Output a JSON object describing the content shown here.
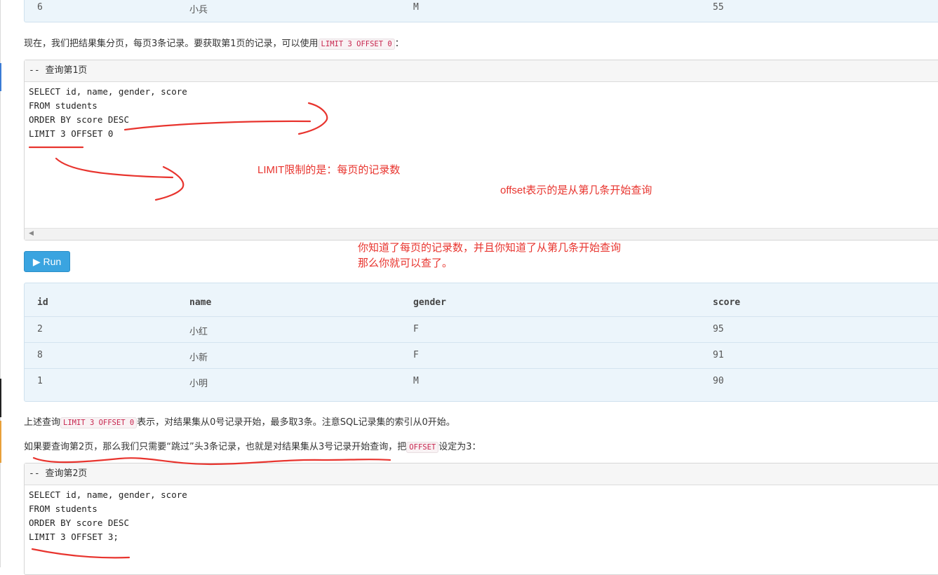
{
  "top_table_row": {
    "id": "6",
    "name": "小兵",
    "gender": "M",
    "score": "55"
  },
  "para1": {
    "before": "现在，我们把结果集分页，每页3条记录。要获取第1页的记录，可以使用",
    "code": "LIMIT 3 OFFSET 0",
    "after": "："
  },
  "code_block1": {
    "header": "-- 查询第1页",
    "lines": [
      "SELECT id, name, gender, score",
      "FROM students",
      "ORDER BY score DESC",
      "LIMIT 3 OFFSET 0"
    ]
  },
  "run_button": {
    "icon": "play-icon",
    "label": "▶ Run"
  },
  "result_table": {
    "columns": [
      "id",
      "name",
      "gender",
      "score"
    ],
    "rows": [
      [
        "2",
        "小红",
        "F",
        "95"
      ],
      [
        "8",
        "小新",
        "F",
        "91"
      ],
      [
        "1",
        "小明",
        "M",
        "90"
      ]
    ]
  },
  "para2": {
    "before": "上述查询",
    "code": "LIMIT 3 OFFSET 0",
    "after": "表示，对结果集从0号记录开始，最多取3条。注意SQL记录集的索引从0开始。"
  },
  "para3": {
    "before": "如果要查询第2页，那么我们只需要“跳过”头3条记录，也就是对结果集从3号记录开始查询，把",
    "code": "OFFSET",
    "after": "设定为3："
  },
  "code_block2": {
    "header": "-- 查询第2页",
    "lines": [
      "SELECT id, name, gender, score",
      "FROM students",
      "ORDER BY score DESC",
      "LIMIT 3 OFFSET 3;"
    ]
  },
  "annotations": {
    "limit_note": "LIMIT限制的是：每页的记录数",
    "offset_note": "offset表示的是从第几条开始查询",
    "summary_line1": "你知道了每页的记录数，并且你知道了从第几条开始查询",
    "summary_line2": "那么你就可以查了。"
  },
  "colors": {
    "annotation": "#e8342e",
    "run_button": "#3aa4e0",
    "result_bg": "#ecf5fb",
    "code_inline": "#c7254e"
  }
}
